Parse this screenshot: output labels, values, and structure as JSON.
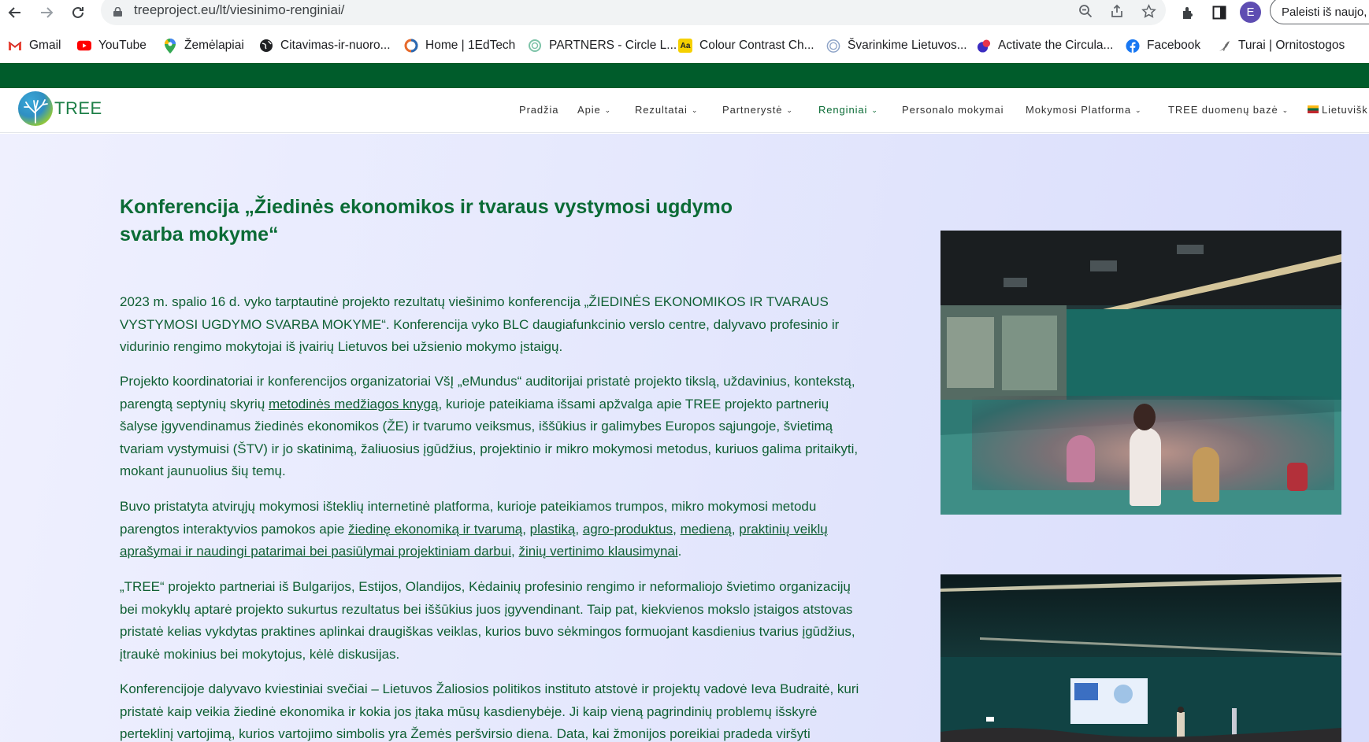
{
  "browser": {
    "url": "treeproject.eu/lt/viesinimo-renginiai/",
    "profile_initial": "E",
    "relaunch_label": "Paleisti iš naujo, ka",
    "bookmarks": [
      {
        "label": "Gmail",
        "icon": "gmail-icon"
      },
      {
        "label": "YouTube",
        "icon": "youtube-icon"
      },
      {
        "label": "Žemėlapiai",
        "icon": "maps-icon"
      },
      {
        "label": "Citavimas-ir-nuoro...",
        "icon": "globe-icon"
      },
      {
        "label": "Home | 1EdTech",
        "icon": "edtech-icon"
      },
      {
        "label": "PARTNERS - Circle L...",
        "icon": "circle-icon"
      },
      {
        "label": "Colour Contrast Ch...",
        "icon": "aa-icon"
      },
      {
        "label": "Švarinkime Lietuvos...",
        "icon": "ring-icon"
      },
      {
        "label": "Activate the Circula...",
        "icon": "activate-icon"
      },
      {
        "label": "Facebook",
        "icon": "facebook-icon"
      },
      {
        "label": "Turai | Ornitostogos",
        "icon": "bird-icon"
      }
    ]
  },
  "site": {
    "logo_text": "TREE",
    "menu": [
      {
        "label": "Pradžia",
        "dropdown": false
      },
      {
        "label": "Apie",
        "dropdown": true
      },
      {
        "label": "Rezultatai",
        "dropdown": true
      },
      {
        "label": "Partnerystė",
        "dropdown": true
      },
      {
        "label": "Renginiai",
        "dropdown": true,
        "active": true
      },
      {
        "label": "Personalo mokymai",
        "dropdown": false
      },
      {
        "label": "Mokymosi Platforma",
        "dropdown": true
      },
      {
        "label": "TREE duomenų bazė",
        "dropdown": true
      },
      {
        "label": "Lietuvišk",
        "dropdown": false,
        "flag": true
      }
    ]
  },
  "article": {
    "title": "Konferencija „Žiedinės ekonomikos ir tvaraus vystymosi ugdymo svarba mokyme“",
    "p1": "2023 m. spalio 16 d. vyko tarptautinė projekto rezultatų viešinimo konferencija „ŽIEDINĖS EKONOMIKOS IR TVARAUS VYSTYMOSI UGDYMO SVARBA MOKYME“. Konferencija vyko BLC daugiafunkcinio verslo centre, dalyvavo profesinio ir vidurinio rengimo mokytojai iš įvairių Lietuvos bei užsienio mokymo įstaigų.",
    "p2_a": "Projekto koordinatoriai ir konferencijos organizatoriai VšĮ „eMundus“ auditorijai pristatė projekto tikslą, uždavinius, kontekstą, parengtą septynių skyrių ",
    "p2_link": "metodinės medžiagos knygą",
    "p2_b": ", kurioje pateikiama išsami apžvalga apie TREE projekto partnerių šalyse įgyvendinamus žiedinės ekonomikos (ŽE) ir tvarumo veiksmus, iššūkius ir galimybes Europos sąjungoje, švietimą tvariam vystymuisi (ŠTV) ir jo skatinimą, žaliuosius įgūdžius, projektinio ir mikro mokymosi metodus, kuriuos galima pritaikyti, mokant jaunuolius šių temų.",
    "p3_a": "Buvo pristatyta atvirųjų mokymosi išteklių internetinė platforma, kurioje pateikiamos trumpos, mikro mokymosi metodu parengtos interaktyvios pamokos apie ",
    "p3_link1": "žiedinę ekonomiką ir tvarumą",
    "p3_sep1": ", ",
    "p3_link2": "plastiką",
    "p3_sep2": ", ",
    "p3_link3": "agro-produktus",
    "p3_sep3": ", ",
    "p3_link4": "medieną",
    "p3_sep4": ", ",
    "p3_link5": "praktinių veiklų aprašymai ir naudingi patarimai bei pasiūlymai projektiniam darbui",
    "p3_sep5": ", ",
    "p3_link6": "žinių vertinimo klausimynai",
    "p3_end": ".",
    "p4": "„TREE“ projekto partneriai iš Bulgarijos, Estijos, Olandijos, Kėdainių profesinio rengimo ir neformaliojo švietimo organizacijų bei mokyklų aptarė projekto sukurtus rezultatus bei iššūkius juos įgyvendinant. Taip pat, kiekvienos mokslo įstaigos atstovas pristatė  kelias  vykdytas praktines aplinkai draugiškas veiklas, kurios buvo sėkmingos formuojant  kasdienius tvarius įgūdžius, įtraukė mokinius bei mokytojus, kėlė diskusijas.",
    "p5": "Konferencijoje dalyvavo kviestiniai svečiai – Lietuvos Žaliosios politikos instituto atstovė ir projektų vadovė Ieva Budraitė, kuri pristatė kaip veikia žiedinė ekonomika ir kokia jos įtaka mūsų kasdienybėje. Ji kaip vieną pagrindinių problemų išskyrė perteklinį vartojimą, kurios vartojimo simbolis yra Žemės peršvirsio diena. Data, kai žmonijos poreikiai pradeda viršyti"
  },
  "colors": {
    "brand_green": "#005c2b",
    "text_green": "#0f5f33",
    "title_green": "#0a6b35"
  }
}
